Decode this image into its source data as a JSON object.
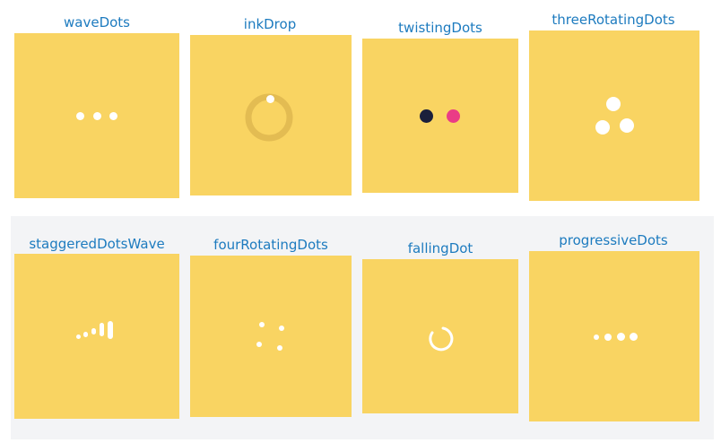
{
  "loaders": [
    {
      "label": "waveDots"
    },
    {
      "label": "inkDrop"
    },
    {
      "label": "twistingDots"
    },
    {
      "label": "threeRotatingDots"
    },
    {
      "label": "staggeredDotsWave"
    },
    {
      "label": "fourRotatingDots"
    },
    {
      "label": "fallingDot"
    },
    {
      "label": "progressiveDots"
    }
  ],
  "colors": {
    "tile_background": "#f9d462",
    "label_text": "#1d7bbf",
    "indicator_white": "#ffffff",
    "ink_ring": "#e3bc52",
    "twisting_dark": "#1b1f3b",
    "twisting_pink": "#ea3c86",
    "row_background": "#f3f4f6"
  }
}
